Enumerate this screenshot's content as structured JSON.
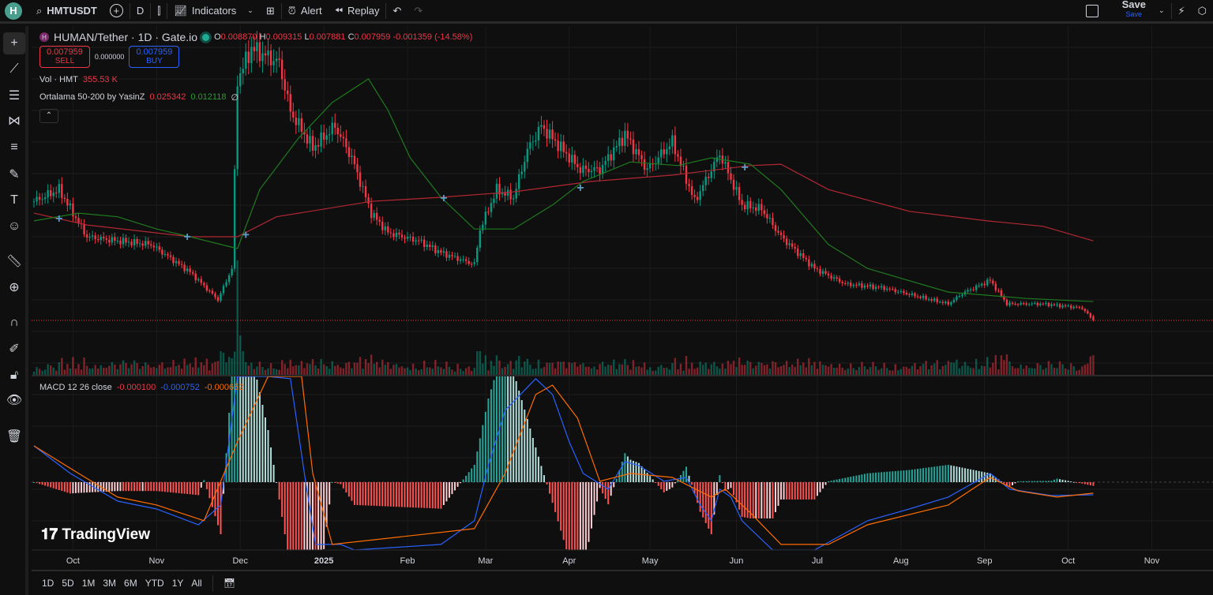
{
  "toolbar": {
    "logo": "H",
    "symbol": "HMTUSDT",
    "interval": "D",
    "indicators": "Indicators",
    "alert": "Alert",
    "replay": "Replay",
    "save": "Save",
    "save_sub": "Save"
  },
  "legend": {
    "title": "HUMAN/Tether · 1D · Gate.io",
    "o_label": "O",
    "o": "0.008870",
    "h_label": "H",
    "h": "0.009315",
    "l_label": "L",
    "l": "0.007881",
    "c_label": "C",
    "c": "0.007959",
    "change": "-0.001359 (-14.58%)",
    "sell_price": "0.007959",
    "sell": "SELL",
    "spread": "0.000000",
    "buy_price": "0.007959",
    "buy": "BUY",
    "vol_label": "Vol · HMT",
    "vol": "355.53 K",
    "ma_label": "Ortalama 50-200 by YasinZ",
    "ma1": "0.025342",
    "ma2": "0.012118",
    "ma_extra": "∅",
    "macd_label": "MACD 12 26 close",
    "hist": "-0.000100",
    "macd": "-0.000752",
    "signal": "-0.000652"
  },
  "brand": "TradingView",
  "ranges": [
    "1D",
    "5D",
    "1M",
    "3M",
    "6M",
    "YTD",
    "1Y",
    "All"
  ],
  "left_tools": [
    "crosshair-icon",
    "trend-line-icon",
    "horizontal-lines-icon",
    "pattern-icon",
    "fib-icon",
    "brush-icon",
    "text-icon",
    "emoji-icon",
    "ruler-icon",
    "zoom-in-icon",
    "magnet-icon",
    "lock-draw-icon",
    "lock-icon",
    "eye-icon",
    "trash-icon"
  ],
  "colors": {
    "up": "#089981",
    "down": "#f23645",
    "ma200": "#b22833",
    "ma50": "#1f7a1f",
    "macd": "#2962ff",
    "signal": "#ff6d00"
  },
  "chart_data": {
    "type": "candlestick",
    "x_unit": "bar index (daily)",
    "last_bar": 380,
    "close_keypoints": [
      [
        0,
        0.0342
      ],
      [
        9,
        0.0368
      ],
      [
        19,
        0.0264
      ],
      [
        30,
        0.0255
      ],
      [
        42,
        0.0247
      ],
      [
        56,
        0.0186
      ],
      [
        66,
        0.0125
      ],
      [
        71,
        0.0194
      ],
      [
        73,
        0.061
      ],
      [
        78,
        0.068
      ],
      [
        88,
        0.0647
      ],
      [
        92,
        0.054
      ],
      [
        100,
        0.046
      ],
      [
        108,
        0.0508
      ],
      [
        114,
        0.0438
      ],
      [
        121,
        0.0316
      ],
      [
        127,
        0.0273
      ],
      [
        138,
        0.0255
      ],
      [
        146,
        0.0229
      ],
      [
        158,
        0.0203
      ],
      [
        160,
        0.028
      ],
      [
        166,
        0.0368
      ],
      [
        172,
        0.035
      ],
      [
        177,
        0.0455
      ],
      [
        182,
        0.0508
      ],
      [
        189,
        0.046
      ],
      [
        196,
        0.0412
      ],
      [
        203,
        0.0412
      ],
      [
        212,
        0.049
      ],
      [
        220,
        0.0412
      ],
      [
        229,
        0.0473
      ],
      [
        237,
        0.0342
      ],
      [
        246,
        0.0447
      ],
      [
        254,
        0.0334
      ],
      [
        261,
        0.0325
      ],
      [
        268,
        0.0264
      ],
      [
        280,
        0.0194
      ],
      [
        291,
        0.016
      ],
      [
        305,
        0.0151
      ],
      [
        316,
        0.0134
      ],
      [
        328,
        0.0116
      ],
      [
        333,
        0.0139
      ],
      [
        343,
        0.0168
      ],
      [
        349,
        0.0116
      ],
      [
        362,
        0.0116
      ],
      [
        376,
        0.0107
      ],
      [
        380,
        0.007959
      ]
    ],
    "ma200": [
      [
        0,
        0.0316
      ],
      [
        19,
        0.029
      ],
      [
        56,
        0.0264
      ],
      [
        73,
        0.0264
      ],
      [
        87,
        0.0308
      ],
      [
        121,
        0.0342
      ],
      [
        146,
        0.0351
      ],
      [
        172,
        0.0363
      ],
      [
        200,
        0.0386
      ],
      [
        229,
        0.04
      ],
      [
        257,
        0.0421
      ],
      [
        268,
        0.0424
      ],
      [
        285,
        0.0368
      ],
      [
        314,
        0.032
      ],
      [
        342,
        0.0299
      ],
      [
        362,
        0.0287
      ],
      [
        380,
        0.0255
      ]
    ],
    "ma50": [
      [
        0,
        0.0299
      ],
      [
        16,
        0.0316
      ],
      [
        30,
        0.0308
      ],
      [
        44,
        0.0281
      ],
      [
        56,
        0.0264
      ],
      [
        73,
        0.0238
      ],
      [
        81,
        0.0368
      ],
      [
        95,
        0.0482
      ],
      [
        107,
        0.056
      ],
      [
        120,
        0.0612
      ],
      [
        127,
        0.0543
      ],
      [
        135,
        0.0438
      ],
      [
        146,
        0.0351
      ],
      [
        158,
        0.0281
      ],
      [
        172,
        0.0281
      ],
      [
        186,
        0.0334
      ],
      [
        197,
        0.0386
      ],
      [
        214,
        0.0429
      ],
      [
        231,
        0.0421
      ],
      [
        243,
        0.0438
      ],
      [
        257,
        0.0424
      ],
      [
        268,
        0.0368
      ],
      [
        285,
        0.0247
      ],
      [
        299,
        0.0194
      ],
      [
        328,
        0.0142
      ],
      [
        356,
        0.0128
      ],
      [
        380,
        0.0121
      ]
    ],
    "cross_signals": [
      [
        9,
        0.0304
      ],
      [
        55,
        0.0264
      ],
      [
        76,
        0.0268
      ],
      [
        147,
        0.0349
      ],
      [
        196,
        0.0372
      ],
      [
        255,
        0.0417
      ]
    ],
    "macd": [
      [
        0,
        0.00216
      ],
      [
        13,
        0.00052
      ],
      [
        30,
        -0.00113
      ],
      [
        44,
        -0.0016
      ],
      [
        59,
        -0.00254
      ],
      [
        67,
        -0.00136
      ],
      [
        73,
        0.00757
      ],
      [
        84,
        0.00992
      ],
      [
        92,
        0.00616
      ],
      [
        97,
        0.00052
      ],
      [
        101,
        -0.00371
      ],
      [
        110,
        -0.00371
      ],
      [
        115,
        -0.00418
      ],
      [
        146,
        -0.00371
      ],
      [
        158,
        -0.0023
      ],
      [
        163,
        0.00099
      ],
      [
        169,
        0.00428
      ],
      [
        180,
        0.00616
      ],
      [
        186,
        0.00522
      ],
      [
        192,
        0.0024
      ],
      [
        197,
        0.00052
      ],
      [
        206,
        -0.00042
      ],
      [
        212,
        0.00122
      ],
      [
        217,
        0.00099
      ],
      [
        226,
        5e-05
      ],
      [
        234,
        0.00028
      ],
      [
        239,
        -0.00136
      ],
      [
        243,
        -0.0023
      ],
      [
        246,
        -0.00042
      ],
      [
        250,
        -0.00089
      ],
      [
        254,
        -0.0023
      ],
      [
        265,
        -0.00418
      ],
      [
        280,
        -0.00418
      ],
      [
        299,
        -0.0023
      ],
      [
        314,
        -0.0016
      ],
      [
        328,
        -0.00089
      ],
      [
        343,
        0.00052
      ],
      [
        350,
        -0.00042
      ],
      [
        365,
        -0.0008
      ],
      [
        380,
        -0.000752
      ]
    ],
    "signal": [
      [
        0,
        0.00216
      ],
      [
        16,
        0.00052
      ],
      [
        30,
        -0.00089
      ],
      [
        44,
        -0.00136
      ],
      [
        61,
        -0.0023
      ],
      [
        73,
        0.0024
      ],
      [
        84,
        0.00851
      ],
      [
        96,
        0.00851
      ],
      [
        100,
        0.00052
      ],
      [
        107,
        -0.00371
      ],
      [
        158,
        -0.00277
      ],
      [
        169,
        0.00052
      ],
      [
        180,
        0.00522
      ],
      [
        186,
        0.00578
      ],
      [
        195,
        0.00381
      ],
      [
        203,
        5e-05
      ],
      [
        214,
        0.00052
      ],
      [
        229,
        0.00028
      ],
      [
        243,
        -0.00089
      ],
      [
        248,
        -0.00042
      ],
      [
        257,
        -0.00183
      ],
      [
        268,
        -0.00371
      ],
      [
        285,
        -0.00371
      ],
      [
        299,
        -0.00254
      ],
      [
        328,
        -0.00136
      ],
      [
        343,
        0.00028
      ],
      [
        353,
        -0.00052
      ],
      [
        367,
        -0.00089
      ],
      [
        380,
        -0.000652
      ]
    ],
    "x_ticks": [
      [
        14,
        "Oct"
      ],
      [
        44,
        "Nov"
      ],
      [
        74,
        "Dec"
      ],
      [
        104,
        "2025"
      ],
      [
        134,
        "Feb"
      ],
      [
        162,
        "Mar"
      ],
      [
        192,
        "Apr"
      ],
      [
        221,
        "May"
      ],
      [
        252,
        "Jun"
      ],
      [
        281,
        "Jul"
      ],
      [
        311,
        "Aug"
      ],
      [
        341,
        "Sep"
      ],
      [
        371,
        "Oct"
      ],
      [
        401,
        "Nov"
      ]
    ],
    "last_price": 0.007959,
    "grid": true
  }
}
